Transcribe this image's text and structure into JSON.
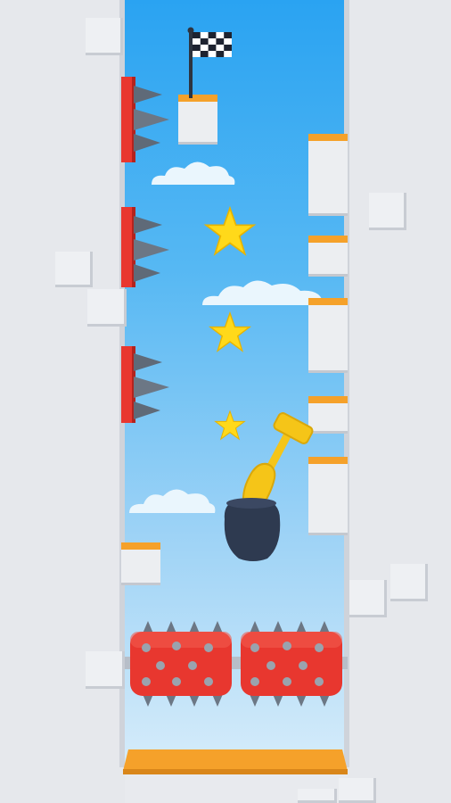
{
  "game": {
    "title": "",
    "goal": "finish-flag",
    "stars_visible": 3,
    "colors": {
      "sky_top": "#2aa3f2",
      "sky_bottom": "#d6ecfa",
      "wall": "#e6e8ec",
      "ledge_top": "#f5a12a",
      "spike_plate": "#e8372f",
      "spike": "#5f6a78",
      "roller": "#e8372f",
      "star": "#ffd91a",
      "hand": "#f5c518",
      "pot": "#2e3a50"
    }
  }
}
